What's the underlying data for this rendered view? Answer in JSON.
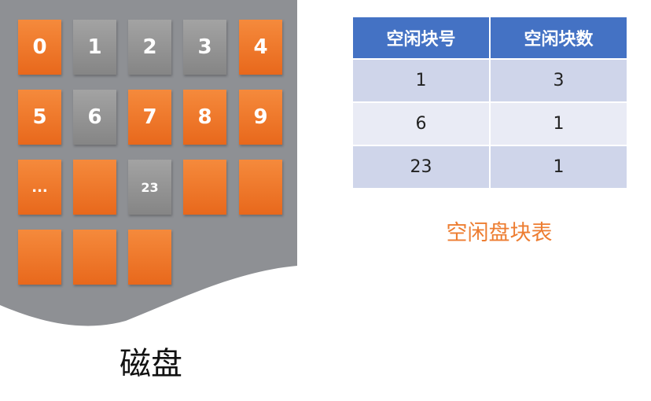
{
  "disk": {
    "label": "磁盘",
    "blocks": [
      {
        "text": "0",
        "state": "free"
      },
      {
        "text": "1",
        "state": "used"
      },
      {
        "text": "2",
        "state": "used"
      },
      {
        "text": "3",
        "state": "used"
      },
      {
        "text": "4",
        "state": "free"
      },
      {
        "text": "5",
        "state": "free"
      },
      {
        "text": "6",
        "state": "used"
      },
      {
        "text": "7",
        "state": "free"
      },
      {
        "text": "8",
        "state": "free"
      },
      {
        "text": "9",
        "state": "free"
      },
      {
        "text": "...",
        "state": "free"
      },
      {
        "text": "",
        "state": "free"
      },
      {
        "text": "23",
        "state": "used"
      },
      {
        "text": "",
        "state": "free"
      },
      {
        "text": "",
        "state": "free"
      },
      {
        "text": "",
        "state": "free"
      },
      {
        "text": "",
        "state": "free"
      },
      {
        "text": "",
        "state": "free"
      }
    ],
    "colors": {
      "free": "#ed7d31",
      "used": "#969696",
      "background": "#8e9094"
    }
  },
  "table": {
    "headers": [
      "空闲块号",
      "空闲块数"
    ],
    "rows": [
      [
        "1",
        "3"
      ],
      [
        "6",
        "1"
      ],
      [
        "23",
        "1"
      ]
    ],
    "caption": "空闲盘块表",
    "colors": {
      "header": "#4472c4",
      "caption": "#ed7d31"
    }
  }
}
